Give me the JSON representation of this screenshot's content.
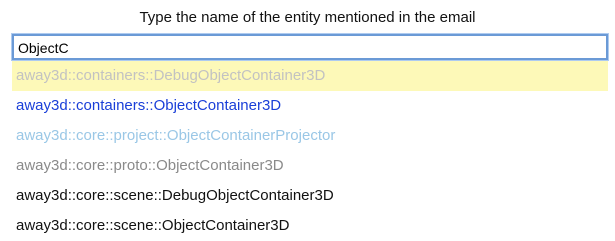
{
  "prompt": {
    "text": "Type the name of the entity mentioned in the email"
  },
  "search": {
    "value": "ObjectC",
    "focus_color": "#6b9ad6"
  },
  "results": [
    {
      "label": "away3d::containers::DebugObjectContainer3D",
      "tone": "faded",
      "highlighted": true
    },
    {
      "label": "away3d::containers::ObjectContainer3D",
      "tone": "link",
      "highlighted": false
    },
    {
      "label": "away3d::core::project::ObjectContainerProjector",
      "tone": "light",
      "highlighted": false
    },
    {
      "label": "away3d::core::proto::ObjectContainer3D",
      "tone": "gray",
      "highlighted": false
    },
    {
      "label": "away3d::core::scene::DebugObjectContainer3D",
      "tone": "normal",
      "highlighted": false
    },
    {
      "label": "away3d::core::scene::ObjectContainer3D",
      "tone": "normal",
      "highlighted": false
    }
  ],
  "colors": {
    "highlight_row": "#fdf9b8",
    "faded": "#c2c2c2",
    "link": "#1a3fd8",
    "light": "#9ac7e6",
    "gray": "#8a8a8a",
    "normal": "#111111"
  }
}
